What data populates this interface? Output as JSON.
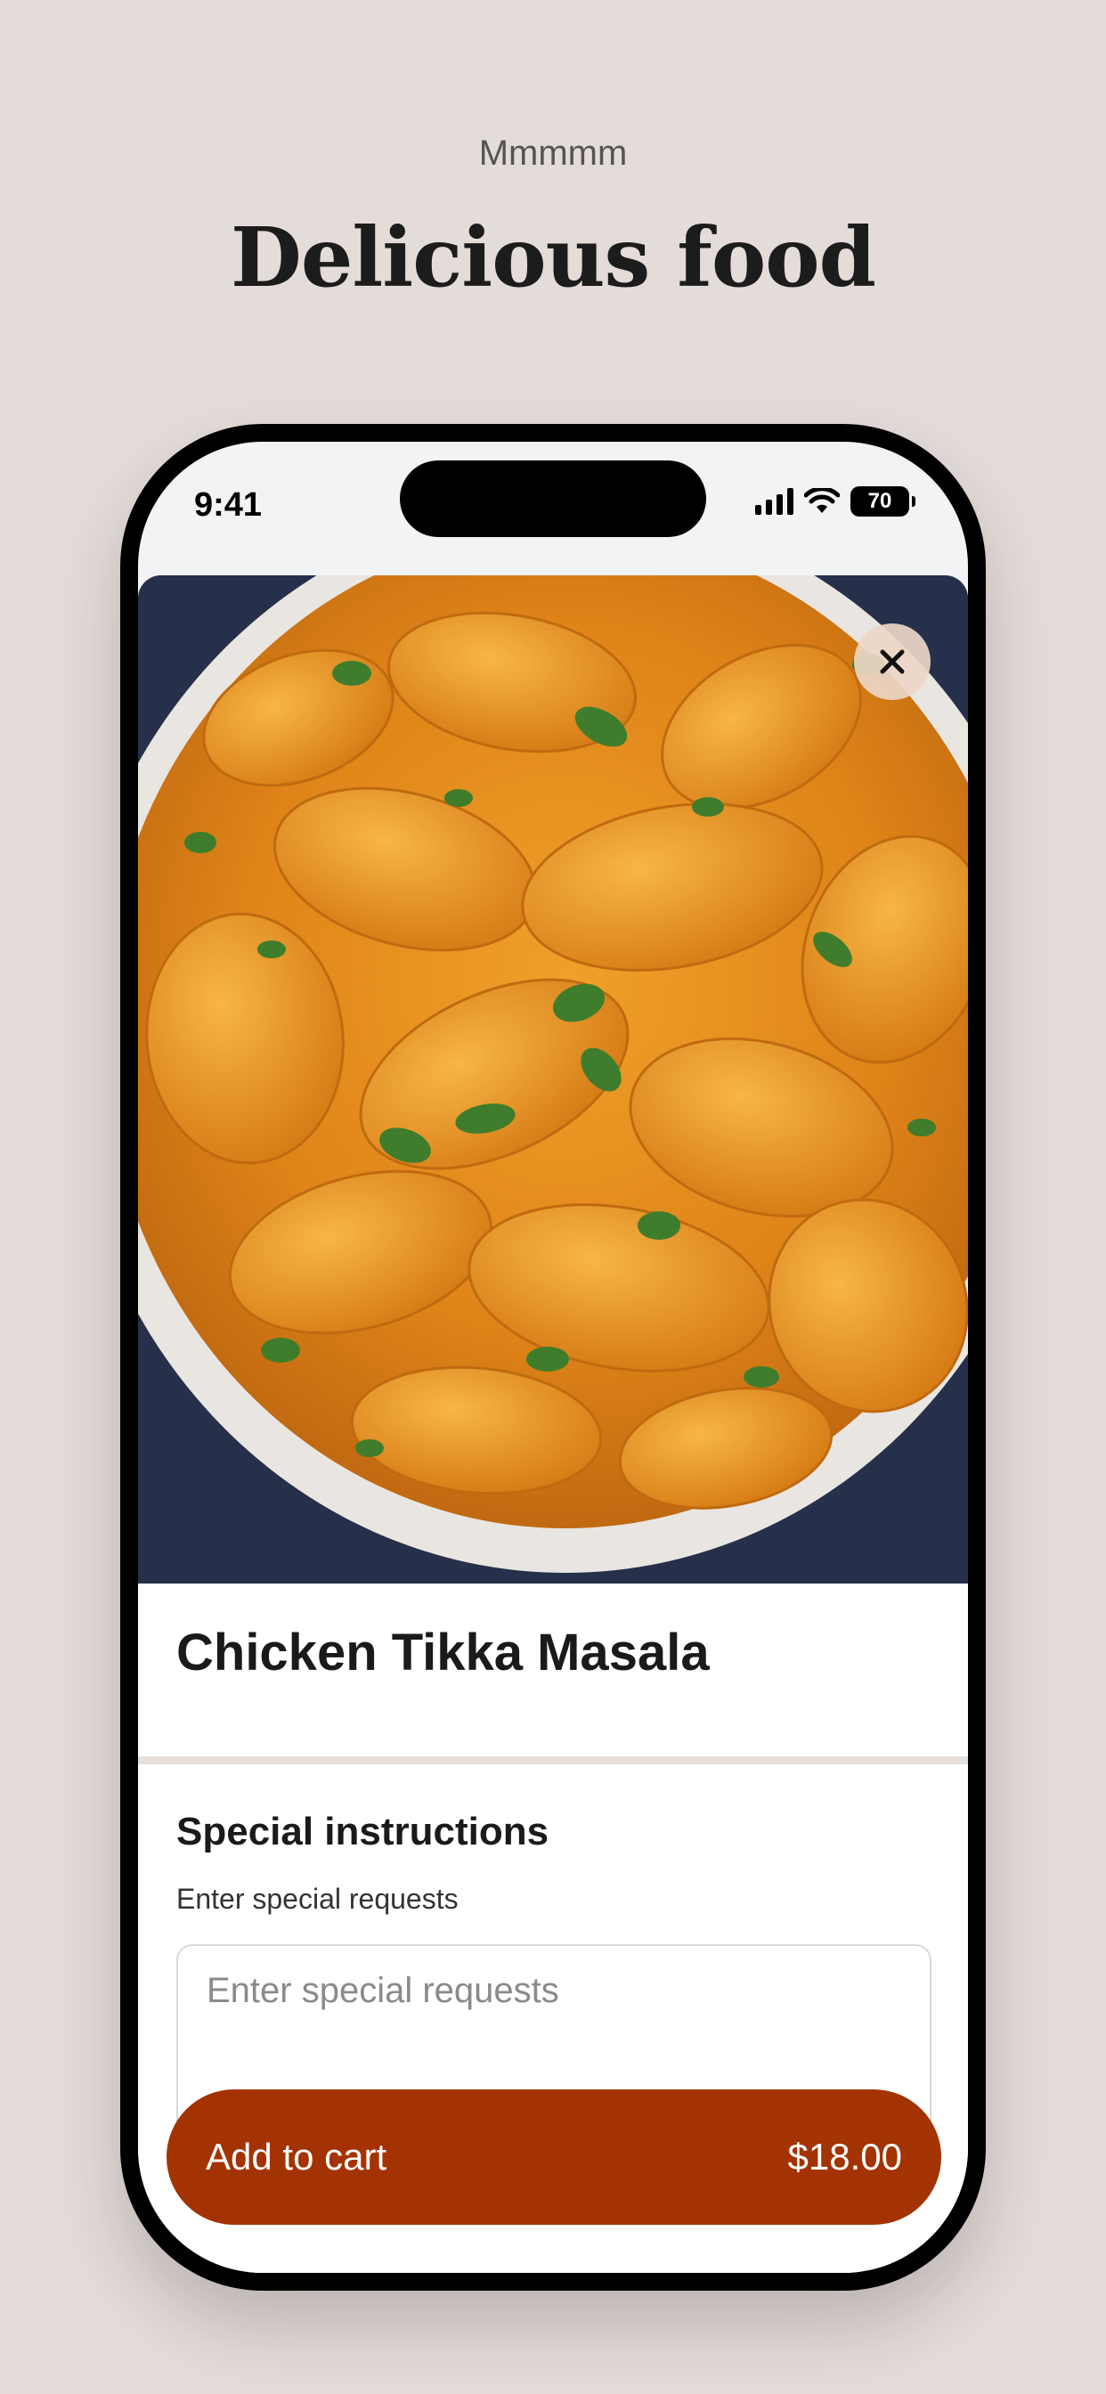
{
  "page": {
    "eyebrow": "Mmmmm",
    "headline": "Delicious food"
  },
  "status_bar": {
    "time": "9:41",
    "battery": "70"
  },
  "item": {
    "image_icon": "food-photo",
    "close_icon": "close-icon",
    "title": "Chicken Tikka Masala"
  },
  "instructions": {
    "title": "Special instructions",
    "label": "Enter special requests",
    "placeholder": "Enter special requests"
  },
  "cart": {
    "label": "Add to cart",
    "price": "$18.00"
  },
  "colors": {
    "page_bg": "#e4dcd9",
    "accent": "#a33303",
    "sauce": "#e08a1e",
    "herb": "#3f7d2c"
  }
}
